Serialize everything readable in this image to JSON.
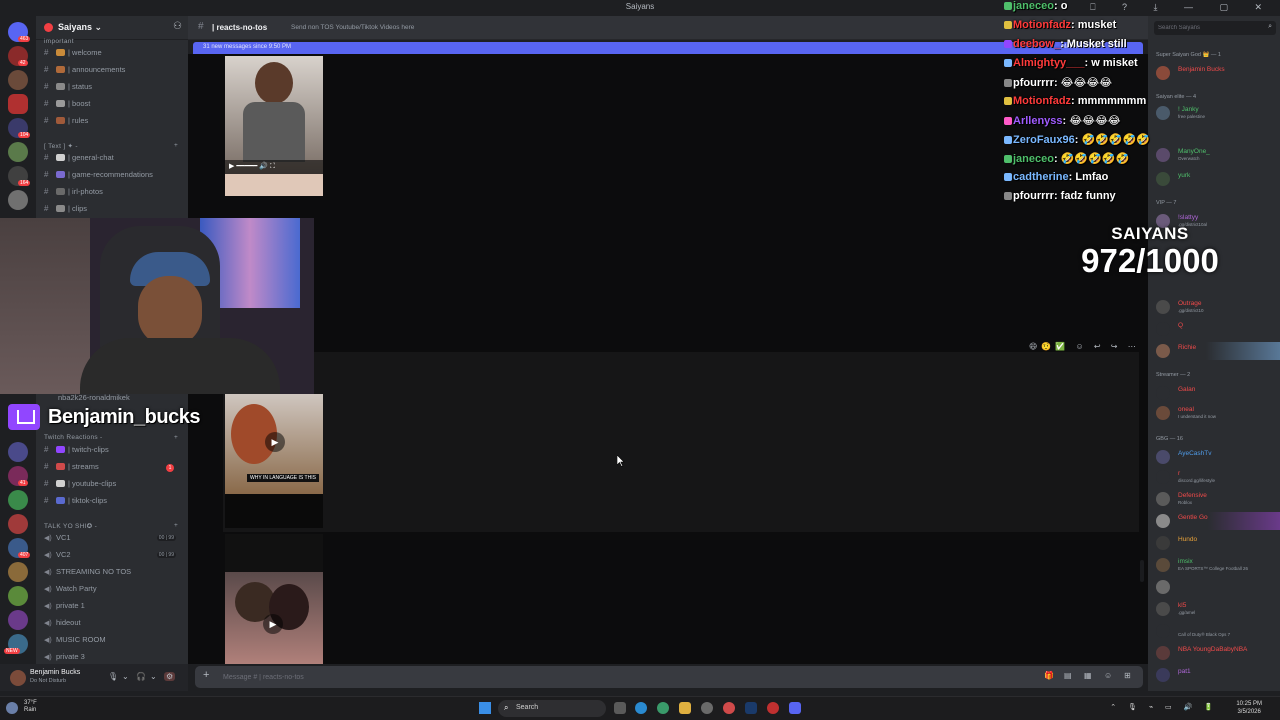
{
  "window": {
    "title": "Saiyans"
  },
  "server": {
    "name": "Saiyans ⌄"
  },
  "sidebar": {
    "category_top": "important",
    "channels": [
      {
        "label": "| welcome",
        "icon": "hash"
      },
      {
        "label": "| announcements",
        "icon": "hash"
      },
      {
        "label": "| status",
        "icon": "hash"
      },
      {
        "label": "| boost",
        "icon": "hash"
      },
      {
        "label": "| rules",
        "icon": "hash"
      }
    ],
    "text_category": "[ Text ] ✦ -",
    "text_channels": [
      {
        "label": "| general-chat"
      },
      {
        "label": "| game-recommendations"
      },
      {
        "label": "| irl-photos"
      },
      {
        "label": "| clips"
      }
    ],
    "hidden_channel": "nba2k26-ronaldmikek",
    "reactions_category": "Twitch Reactions -",
    "reaction_channels": [
      {
        "label": "| twitch-clips"
      },
      {
        "label": "| streams",
        "unread": "1"
      },
      {
        "label": "| youtube-clips"
      },
      {
        "label": "| tiktok-clips"
      }
    ],
    "voice_category": "TALK YO SHI✪ -",
    "voice_channels": [
      {
        "label": "VC1",
        "badge": "00 | 99"
      },
      {
        "label": "VC2",
        "badge": "00 | 99"
      },
      {
        "label": "STREAMING NO TOS"
      },
      {
        "label": "Watch Party"
      },
      {
        "label": "private 1"
      },
      {
        "label": "hideout"
      },
      {
        "label": "MUSIC ROOM"
      },
      {
        "label": "private 3"
      }
    ]
  },
  "rail_badges": [
    "463",
    "42",
    "104",
    "164",
    "41",
    "407",
    "NEW"
  ],
  "user_panel": {
    "name": "Benjamin Bucks",
    "status": "Do Not Disturb"
  },
  "channel": {
    "name": "| reacts-no-tos",
    "topic": "Send non TOS Youtube/Tiktok Videos here",
    "new_messages": "31 new messages since 9:50 PM",
    "mark_read": "Mark As Read",
    "composer_placeholder": "Message # | reacts-no-tos"
  },
  "media": [
    {
      "caption": ""
    },
    {
      "caption": ""
    },
    {
      "caption": "WHY IN LANGUAGE IS THIS"
    },
    {
      "caption": ""
    }
  ],
  "members": {
    "search_placeholder": "Search Saiyans",
    "groups": [
      {
        "label": "Super Saiyan God 👑 — 1",
        "members": [
          {
            "name": "Benjamin Bucks",
            "color": "#f04a4a",
            "sub": ""
          }
        ]
      },
      {
        "label": "Saiyan elite — 4",
        "members": [
          {
            "name": "! Janky",
            "color": "#4fbf6b",
            "sub": "free palestine"
          },
          {
            "name": "ManyOne_",
            "color": "#4fbf6b",
            "sub": "Overwatch"
          },
          {
            "name": "yurk",
            "color": "#4fbf6b",
            "sub": ""
          }
        ]
      },
      {
        "label": "VIP — 7",
        "members": [
          {
            "name": "!slattyy",
            "color": "#b067d9",
            "sub": ".gg/district10al"
          },
          {
            "name": "Outrage",
            "color": "#f04a4a",
            "sub": ".gg/district10"
          },
          {
            "name": "Q",
            "color": "#f04a4a",
            "sub": ""
          },
          {
            "name": "Richie",
            "color": "#f04a4a",
            "sub": ""
          }
        ]
      },
      {
        "label": "Streamer — 2",
        "members": [
          {
            "name": "Galan",
            "color": "#f04a4a",
            "sub": ""
          },
          {
            "name": "oneal",
            "color": "#f04a4a",
            "sub": "I understand it now"
          }
        ]
      },
      {
        "label": "GBG — 16",
        "members": [
          {
            "name": "AyeCashTv",
            "color": "#4f9be8",
            "sub": ""
          },
          {
            "name": "r",
            "color": "#f04a4a",
            "sub": "discord.gg/lifestyle"
          },
          {
            "name": "Defensive",
            "color": "#f04a4a",
            "sub": "Roblox"
          },
          {
            "name": "Gentle Gonzo",
            "color": "#f04a4a",
            "sub": ""
          },
          {
            "name": "Hundo",
            "color": "#e8a23a",
            "sub": ""
          },
          {
            "name": "imsix",
            "color": "#4fbf6b",
            "sub": "EA SPORTS™ College Football 26"
          },
          {
            "name": "",
            "color": "#f04a4a",
            "sub": ""
          },
          {
            "name": "kl5",
            "color": "#f04a4a",
            "sub": ".gg/amel"
          },
          {
            "name": "",
            "color": "#b067d9",
            "sub": "Call of Duty® Black Ops 7"
          },
          {
            "name": "NBA YoungDaBabyNBA",
            "color": "#f04a4a",
            "sub": ""
          },
          {
            "name": "pat1",
            "color": "#b067d9",
            "sub": ""
          }
        ]
      }
    ]
  },
  "chat_overlay": [
    {
      "user": "janeceo",
      "color": "#4fbf6b",
      "msg": ": o"
    },
    {
      "user": "Motionfadz",
      "color": "#ff3b3b",
      "msg": ": musket"
    },
    {
      "user": "deebow_",
      "color": "#ff3b3b",
      "msg": ": Musket still"
    },
    {
      "user": "Almightyy___",
      "color": "#ff3b3b",
      "msg": ": w misket"
    },
    {
      "user": "pfourrrr",
      "color": "#ffffff",
      "msg": ": 😂😂😂😂"
    },
    {
      "user": "Motionfadz",
      "color": "#ff3b3b",
      "msg": ": mmmmmmm"
    },
    {
      "user": "Arllenyss",
      "color": "#a05cff",
      "msg": ": 😂😂😂😂"
    },
    {
      "user": "ZeroFaux96",
      "color": "#7ab8ff",
      "msg": ": 🤣🤣🤣🤣🤣"
    },
    {
      "user": "janeceo",
      "color": "#4fbf6b",
      "msg": ": 🤣🤣🤣🤣🤣"
    },
    {
      "user": "cadtherine",
      "color": "#7ab8ff",
      "msg": ": Lmfao"
    },
    {
      "user": "pfourrrr",
      "color": "#ffffff",
      "msg": ": fadz funny"
    }
  ],
  "goal": {
    "label": "SAIYANS",
    "value": "972/1000"
  },
  "twitch": {
    "handle": "Benjamin_bucks"
  },
  "taskbar": {
    "weather_temp": "37°F",
    "weather_cond": "Rain",
    "search": "Search",
    "time": "10:25 PM",
    "date": "3/5/2026"
  }
}
